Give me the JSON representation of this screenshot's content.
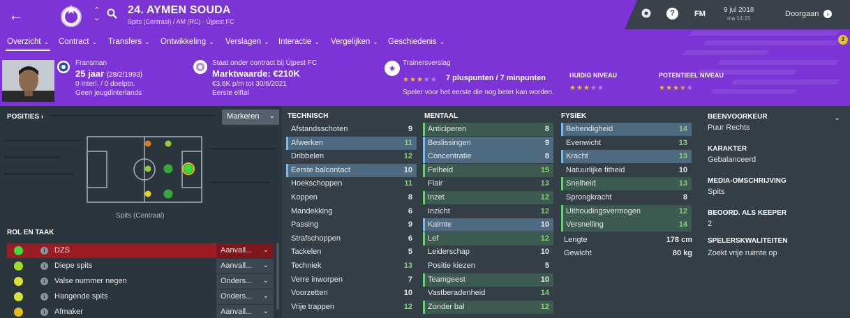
{
  "header": {
    "player_name": "24. AYMEN SOUDA",
    "player_sub": "Spits (Centraal) / AM (RC) - Újpest FC",
    "date": "9 jul 2018",
    "time": "ma 14:15",
    "continue_label": "Doorgaan",
    "fm_label": "FM",
    "notification_count": "2"
  },
  "tabs": [
    {
      "label": "Overzicht"
    },
    {
      "label": "Contract"
    },
    {
      "label": "Transfers"
    },
    {
      "label": "Ontwikkeling"
    },
    {
      "label": "Verslagen"
    },
    {
      "label": "Interactie"
    },
    {
      "label": "Vergelijken"
    },
    {
      "label": "Geschiedenis"
    }
  ],
  "info": {
    "nationality": "Fransman",
    "age": "25 jaar",
    "dob": "(28/2/1993)",
    "caps": "0 Interl. / 0 doelptn.",
    "youth": "Geen jeugdinterlands",
    "contract_label": "Staat onder contract bij Újpest FC",
    "market_value": "Marktwaarde: €210K",
    "wage": "€3,6K p/m tot 30/6/2021",
    "squad": "Eerste elftal"
  },
  "coach": {
    "title": "Trainersverslag",
    "stars_filled": 3,
    "stars_total": 5,
    "points": "7 pluspunten / 7 minpunten",
    "description": "Speler voor het eerste die nog beter kan worden.",
    "current_label": "HUIDIG NIVEAU",
    "current_stars": 3,
    "potential_label": "POTENTIEEL NIVEAU",
    "potential_stars": 3.5
  },
  "positions": {
    "title": "POSITIES ›",
    "button": "Markeren",
    "caption": "Spits (Centraal)"
  },
  "roles": {
    "title": "ROL EN TAAK",
    "items": [
      {
        "name": "DZS",
        "duty": "Aanvall...",
        "color": "#3fdc3f"
      },
      {
        "name": "Diepe spits",
        "duty": "Aanvall...",
        "color": "#9fdc2a"
      },
      {
        "name": "Valse nummer negen",
        "duty": "Onders...",
        "color": "#d7e234"
      },
      {
        "name": "Hangende spits",
        "duty": "Onders...",
        "color": "#d7e234"
      },
      {
        "name": "Afmaker",
        "duty": "Aanvall...",
        "color": "#e0c020"
      }
    ]
  },
  "attributes": {
    "technical": {
      "title": "TECHNISCH",
      "items": [
        {
          "name": "Afstandsschoten",
          "value": "9",
          "hl": "",
          "good": false
        },
        {
          "name": "Afwerken",
          "value": "11",
          "hl": "blue",
          "good": true
        },
        {
          "name": "Dribbelen",
          "value": "12",
          "hl": "",
          "good": true
        },
        {
          "name": "Eerste balcontact",
          "value": "10",
          "hl": "blue",
          "good": false
        },
        {
          "name": "Hoekschoppen",
          "value": "11",
          "hl": "",
          "good": true
        },
        {
          "name": "Koppen",
          "value": "8",
          "hl": "",
          "good": false
        },
        {
          "name": "Mandekking",
          "value": "6",
          "hl": "",
          "good": false
        },
        {
          "name": "Passing",
          "value": "9",
          "hl": "",
          "good": false
        },
        {
          "name": "Strafschoppen",
          "value": "6",
          "hl": "",
          "good": false
        },
        {
          "name": "Tackelen",
          "value": "5",
          "hl": "",
          "good": false
        },
        {
          "name": "Techniek",
          "value": "13",
          "hl": "",
          "good": true
        },
        {
          "name": "Verre inworpen",
          "value": "7",
          "hl": "",
          "good": false
        },
        {
          "name": "Voorzetten",
          "value": "10",
          "hl": "",
          "good": false
        },
        {
          "name": "Vrije trappen",
          "value": "12",
          "hl": "",
          "good": true
        }
      ]
    },
    "mental": {
      "title": "MENTAAL",
      "items": [
        {
          "name": "Anticiperen",
          "value": "8",
          "hl": "green",
          "good": false
        },
        {
          "name": "Beslissingen",
          "value": "9",
          "hl": "blue",
          "good": false
        },
        {
          "name": "Concentratie",
          "value": "8",
          "hl": "blue",
          "good": false
        },
        {
          "name": "Felheid",
          "value": "15",
          "hl": "green",
          "good": true
        },
        {
          "name": "Flair",
          "value": "13",
          "hl": "",
          "good": true
        },
        {
          "name": "Inzet",
          "value": "12",
          "hl": "green",
          "good": true
        },
        {
          "name": "Inzicht",
          "value": "12",
          "hl": "",
          "good": true
        },
        {
          "name": "Kalmte",
          "value": "10",
          "hl": "blue",
          "good": false
        },
        {
          "name": "Lef",
          "value": "12",
          "hl": "green",
          "good": true
        },
        {
          "name": "Leiderschap",
          "value": "10",
          "hl": "",
          "good": false
        },
        {
          "name": "Positie kiezen",
          "value": "5",
          "hl": "",
          "good": false
        },
        {
          "name": "Teamgeest",
          "value": "10",
          "hl": "green",
          "good": false
        },
        {
          "name": "Vastberadenheid",
          "value": "14",
          "hl": "",
          "good": true
        },
        {
          "name": "Zonder bal",
          "value": "12",
          "hl": "green",
          "good": true
        }
      ]
    },
    "physical": {
      "title": "FYSIEK",
      "items": [
        {
          "name": "Behendigheid",
          "value": "14",
          "hl": "blue",
          "good": true
        },
        {
          "name": "Evenwicht",
          "value": "13",
          "hl": "",
          "good": true
        },
        {
          "name": "Kracht",
          "value": "13",
          "hl": "blue",
          "good": true
        },
        {
          "name": "Natuurlijke fitheid",
          "value": "10",
          "hl": "",
          "good": false
        },
        {
          "name": "Snelheid",
          "value": "13",
          "hl": "green",
          "good": true
        },
        {
          "name": "Sprongkracht",
          "value": "8",
          "hl": "",
          "good": false
        },
        {
          "name": "Uithoudingsvermogen",
          "value": "12",
          "hl": "green",
          "good": true
        },
        {
          "name": "Versnelling",
          "value": "14",
          "hl": "green",
          "good": true
        }
      ],
      "height_label": "Lengte",
      "height_value": "178 cm",
      "weight_label": "Gewicht",
      "weight_value": "80 kg"
    }
  },
  "side": {
    "foot_label": "BEENVOORKEUR",
    "foot_value": "Puur Rechts",
    "character_label": "KARAKTER",
    "character_value": "Gebalanceerd",
    "media_label": "MEDIA-OMSCHRIJVING",
    "media_value": "Spits",
    "keeper_label": "BEOORD. ALS KEEPER",
    "keeper_value": "2",
    "traits_label": "SPELERSKWALITEITEN",
    "traits_value": "Zoekt vrije ruimte op"
  },
  "colors": {
    "header_purple": "#7d34d6",
    "panel_dark": "#2b353e",
    "highlight_blue": "#4d6a80",
    "highlight_green": "#3c5a4f",
    "good_value": "#8ad17a",
    "role_active": "#9b1c22"
  }
}
